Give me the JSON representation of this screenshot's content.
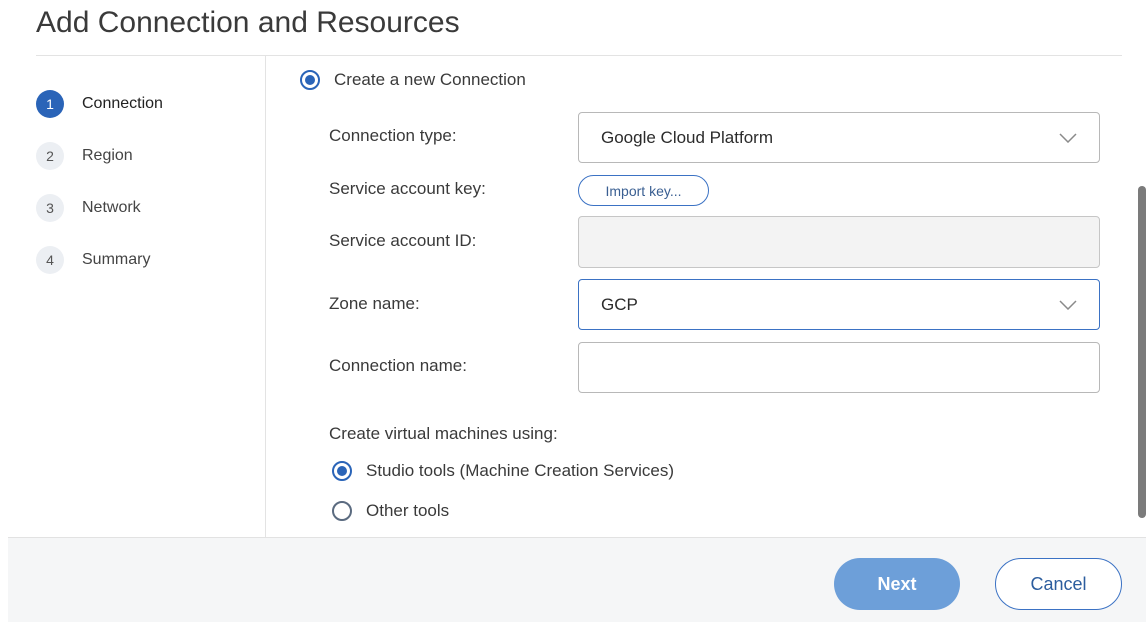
{
  "page": {
    "title": "Add Connection and Resources"
  },
  "steps": [
    {
      "num": "1",
      "label": "Connection",
      "active": true
    },
    {
      "num": "2",
      "label": "Region",
      "active": false
    },
    {
      "num": "3",
      "label": "Network",
      "active": false
    },
    {
      "num": "4",
      "label": "Summary",
      "active": false
    }
  ],
  "form": {
    "create_new_label": "Create a new Connection",
    "connection_type": {
      "label": "Connection type:",
      "value": "Google Cloud Platform"
    },
    "service_account_key": {
      "label": "Service account key:",
      "button": "Import key..."
    },
    "service_account_id": {
      "label": "Service account ID:",
      "value": ""
    },
    "zone_name": {
      "label": "Zone name:",
      "value": "GCP"
    },
    "connection_name": {
      "label": "Connection name:",
      "value": ""
    },
    "vm_heading": "Create virtual machines using:",
    "vm_options": [
      {
        "label": "Studio tools (Machine Creation Services)",
        "checked": true
      },
      {
        "label": "Other tools",
        "checked": false
      }
    ]
  },
  "footer": {
    "next_label": "Next",
    "cancel_label": "Cancel"
  },
  "colors": {
    "accent": "#2a64b8",
    "next_button": "#6d9fd9",
    "footer_bg": "#f5f6f7"
  },
  "icons": {
    "dropdown": "chevron-down-icon"
  }
}
